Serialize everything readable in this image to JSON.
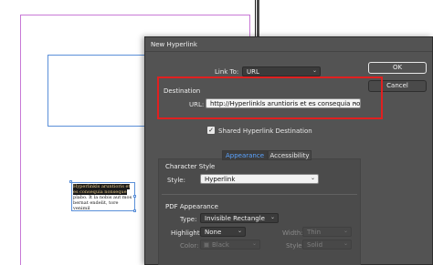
{
  "document": {
    "frame_text_highlighted": "Hyperlinkls aruntioris et es consequia nonseque",
    "frame_text_rest": " plabo. It la nobis aut mos bernat endelit, tore venimil"
  },
  "dialog": {
    "title": "New Hyperlink",
    "link_to": {
      "label": "Link To:",
      "value": "URL"
    },
    "destination": {
      "heading": "Destination",
      "url_label": "URL:",
      "url_value": "http://Hyperlinkls aruntioris et es consequia nonsec"
    },
    "shared_checkbox": {
      "label": "Shared Hyperlink Destination",
      "checked": true
    },
    "buttons": {
      "ok": "OK",
      "cancel": "Cancel"
    },
    "tabs": [
      {
        "label": "Appearance",
        "active": true
      },
      {
        "label": "Accessibility",
        "active": false
      }
    ],
    "character_style": {
      "heading": "Character Style",
      "style_label": "Style:",
      "style_value": "Hyperlink"
    },
    "pdf_appearance": {
      "heading": "PDF Appearance",
      "type_label": "Type:",
      "type_value": "Invisible Rectangle",
      "highlight_label": "Highlight:",
      "highlight_value": "None",
      "width_label": "Width:",
      "width_value": "Thin",
      "color_label": "Color:",
      "color_value": "Black",
      "style_label": "Style:",
      "style_value": "Solid"
    }
  },
  "colors": {
    "dialog_bg": "#535353",
    "annotation_red": "#e02020",
    "active_tab": "#5aa3ff",
    "guide_magenta": "#c879d6",
    "frame_blue": "#5a8fd8"
  },
  "icons": {
    "dropdown": "chevron-down-icon",
    "check": "checkmark-icon"
  }
}
